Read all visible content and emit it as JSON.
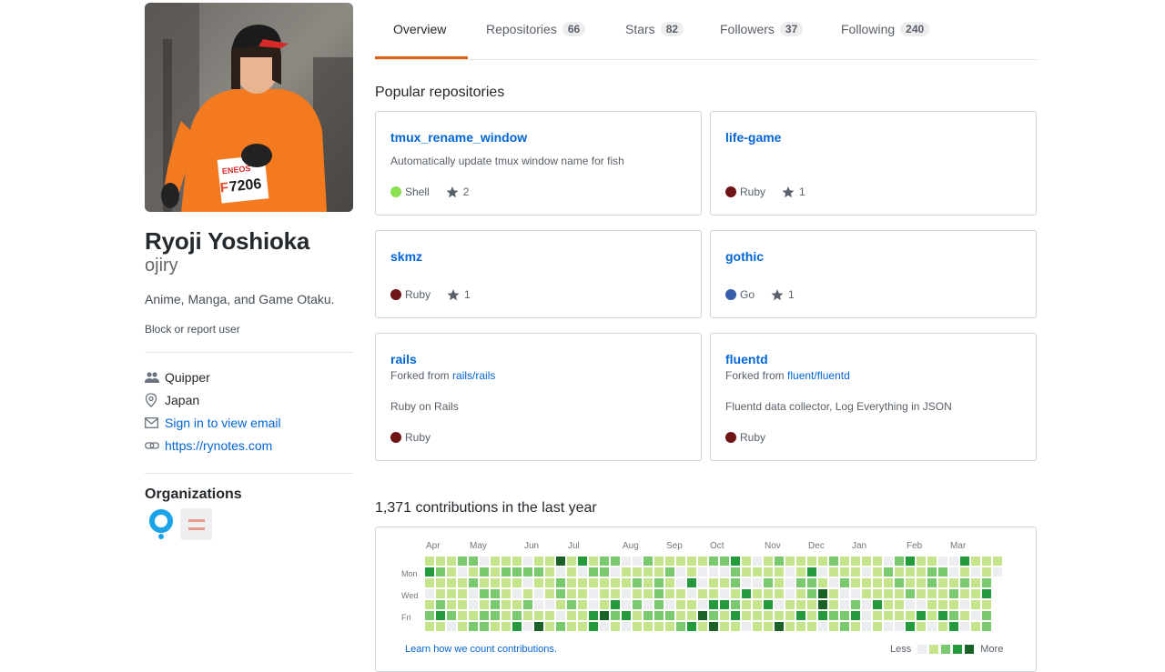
{
  "profile": {
    "fullname": "Ryoji Yoshioka",
    "username": "ojiry",
    "bio": "Anime, Manga, and Game Otaku.",
    "block_report": "Block or report user",
    "company": "Quipper",
    "location": "Japan",
    "email_link": "Sign in to view email",
    "website": "https://rynotes.com",
    "organizations_title": "Organizations",
    "avatar_bib_brand": "ENEOS",
    "avatar_bib_number": "7206",
    "avatar_bib_prefix": "F"
  },
  "tabs": [
    {
      "label": "Overview",
      "count": ""
    },
    {
      "label": "Repositories",
      "count": "66"
    },
    {
      "label": "Stars",
      "count": "82"
    },
    {
      "label": "Followers",
      "count": "37"
    },
    {
      "label": "Following",
      "count": "240"
    }
  ],
  "popular_title": "Popular repositories",
  "repos": [
    {
      "name": "tmux_rename_window",
      "forked_label": "",
      "forked_from": "",
      "description": "Automatically update tmux window name for fish",
      "language": "Shell",
      "color": "#89e051",
      "stars": "2"
    },
    {
      "name": "life-game",
      "forked_label": "",
      "forked_from": "",
      "description": "",
      "language": "Ruby",
      "color": "#701516",
      "stars": "1"
    },
    {
      "name": "skmz",
      "forked_label": "",
      "forked_from": "",
      "description": "",
      "language": "Ruby",
      "color": "#701516",
      "stars": "1"
    },
    {
      "name": "gothic",
      "forked_label": "",
      "forked_from": "",
      "description": "",
      "language": "Go",
      "color": "#375eab",
      "stars": "1"
    },
    {
      "name": "rails",
      "forked_label": "Forked from",
      "forked_from": "rails/rails",
      "description": "Ruby on Rails",
      "language": "Ruby",
      "color": "#701516",
      "stars": ""
    },
    {
      "name": "fluentd",
      "forked_label": "Forked from",
      "forked_from": "fluent/fluentd",
      "description": "Fluentd data collector, Log Everything in JSON",
      "language": "Ruby",
      "color": "#701516",
      "stars": ""
    }
  ],
  "contributions": {
    "title": "1,371 contributions in the last year",
    "months": [
      "Apr",
      "May",
      "Jun",
      "Jul",
      "Aug",
      "Sep",
      "Oct",
      "Nov",
      "Dec",
      "Jan",
      "Feb",
      "Mar"
    ],
    "weekdays": [
      "Mon",
      "Wed",
      "Fri"
    ],
    "learn_link": "Learn how we count contributions.",
    "legend_less": "Less",
    "legend_more": "More",
    "level_colors": [
      "#ebedf0",
      "#c6e48b",
      "#7bc96f",
      "#239a3b",
      "#196127"
    ]
  }
}
